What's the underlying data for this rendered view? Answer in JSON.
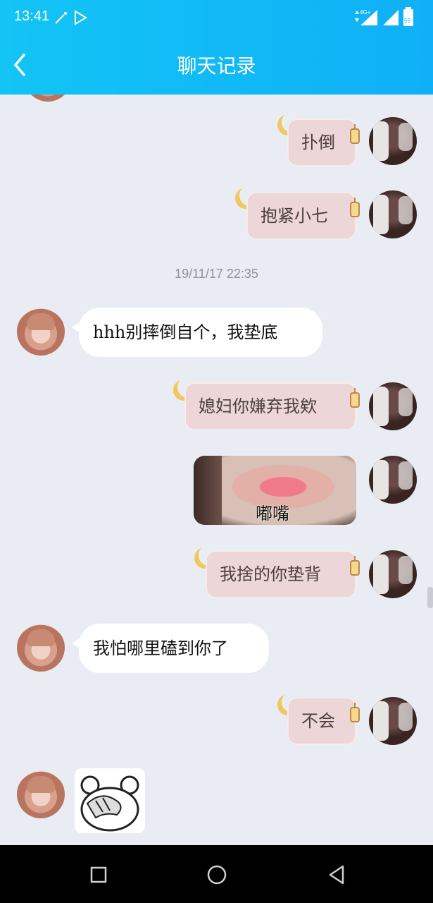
{
  "status_bar": {
    "time": "13:41",
    "network": "4G+",
    "battery": "59"
  },
  "header": {
    "title": "聊天记录"
  },
  "chat": {
    "timestamp": "19/11/17 22:35",
    "messages": [
      {
        "from": "me",
        "text": "扑倒"
      },
      {
        "from": "me",
        "text": "抱紧小七"
      },
      {
        "from": "her",
        "text": "hhh别摔倒自个，我垫底"
      },
      {
        "from": "me",
        "text": "媳妇你嫌弃我欸"
      },
      {
        "from": "me",
        "type": "image",
        "caption": "嘟嘴"
      },
      {
        "from": "me",
        "text": "我捨的你垫背"
      },
      {
        "from": "her",
        "text": "我怕哪里磕到你了"
      },
      {
        "from": "me",
        "text": "不会"
      },
      {
        "from": "her",
        "type": "sticker"
      }
    ]
  },
  "colors": {
    "header": "#13c4f5",
    "background": "#e9edf3",
    "my_bubble": "#ecd6d8",
    "her_bubble": "#ffffff"
  }
}
